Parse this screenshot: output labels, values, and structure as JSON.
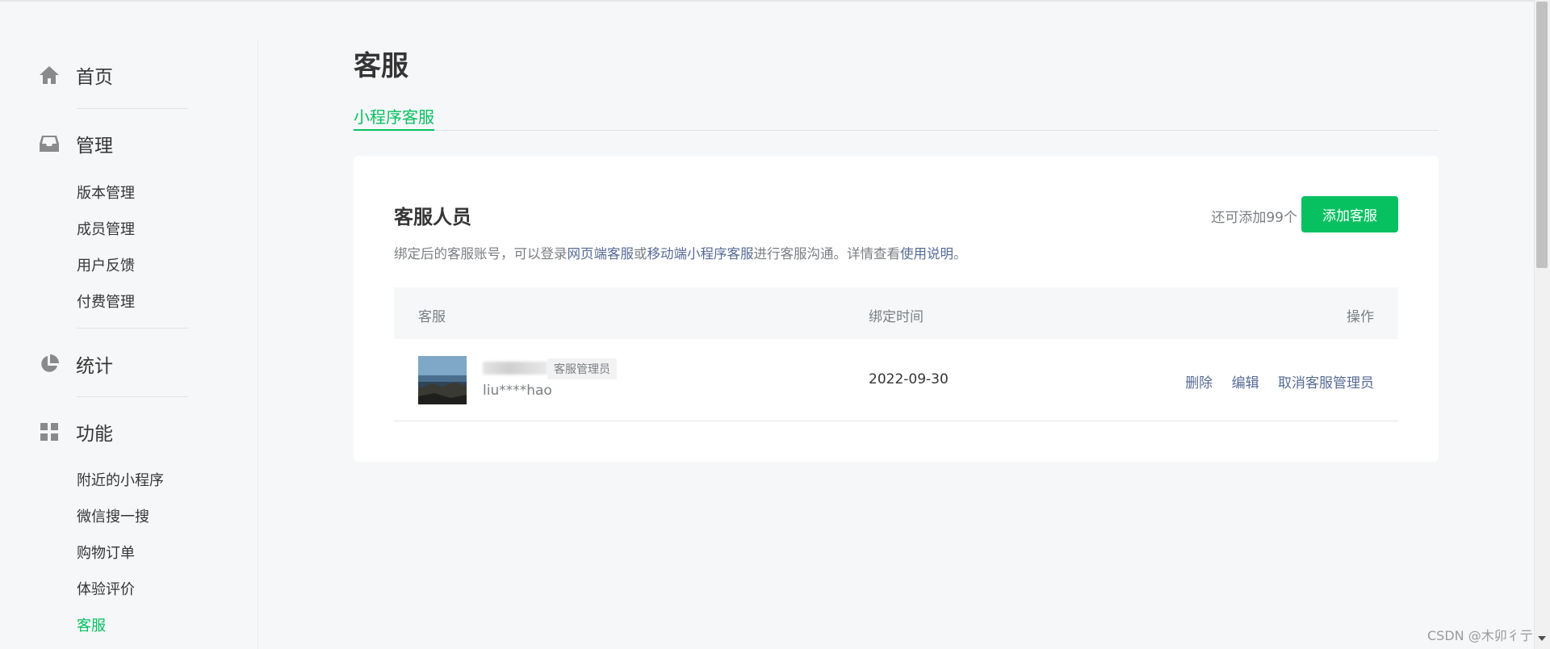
{
  "sidebar": {
    "home": {
      "label": "首页",
      "icon": "home-icon"
    },
    "manage": {
      "label": "管理",
      "icon": "inbox-icon",
      "items": [
        "版本管理",
        "成员管理",
        "用户反馈",
        "付费管理"
      ]
    },
    "stats": {
      "label": "统计",
      "icon": "pie-chart-icon"
    },
    "features": {
      "label": "功能",
      "icon": "grid-icon",
      "items": [
        "附近的小程序",
        "微信搜一搜",
        "购物订单",
        "体验评价",
        "客服"
      ]
    }
  },
  "main": {
    "title": "客服",
    "tab": "小程序客服",
    "card": {
      "title": "客服人员",
      "remaining": "还可添加99个",
      "add_button": "添加客服",
      "desc": {
        "part1": "绑定后的客服账号，可以登录",
        "link1": "网页端客服",
        "part2": "或",
        "link2": "移动端小程序客服",
        "part3": "进行客服沟通。详情查看",
        "link3": "使用说明",
        "part4": "。"
      },
      "table": {
        "headers": {
          "agent": "客服",
          "bind_time": "绑定时间",
          "ops": "操作"
        },
        "rows": [
          {
            "badge": "客服管理员",
            "username": "liu****hao",
            "bind_time": "2022-09-30",
            "ops": [
              "删除",
              "编辑",
              "取消客服管理员"
            ]
          }
        ]
      }
    }
  },
  "watermark": "CSDN @木卯彳亍",
  "colors": {
    "accent": "#07c160",
    "link": "#576b95"
  }
}
